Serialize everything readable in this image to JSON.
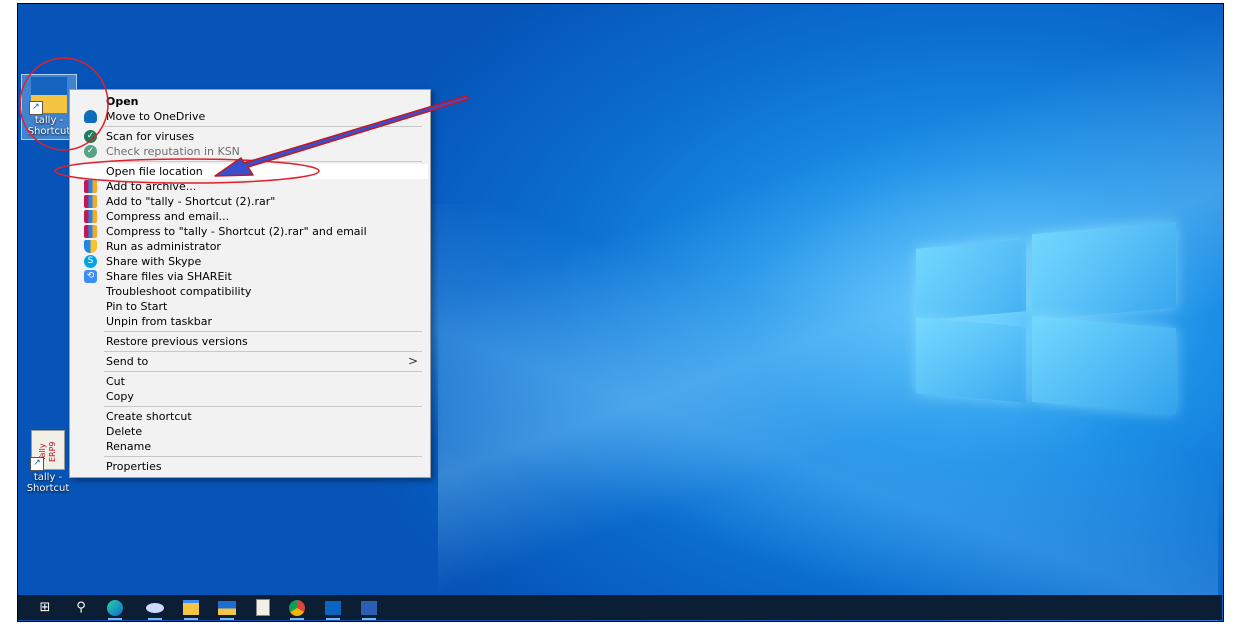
{
  "desktop": {
    "icons": [
      {
        "label": "tally - Shortcut",
        "name": "tally-shortcut-selected"
      },
      {
        "label": "tally - Shortcut",
        "name": "tally-erp9-shortcut"
      }
    ],
    "icon2_art_text": "Tally ERP9"
  },
  "context_menu": {
    "items": {
      "open": "Open",
      "move_onedrive": "Move to OneDrive",
      "scan": "Scan for viruses",
      "check_reputation": "Check reputation in KSN",
      "open_file_location": "Open file location",
      "add_archive": "Add to archive...",
      "add_to_rar": "Add to \"tally - Shortcut (2).rar\"",
      "compress_email": "Compress and email...",
      "compress_to_rar_email": "Compress to \"tally - Shortcut (2).rar\" and email",
      "run_admin": "Run as administrator",
      "share_skype": "Share with Skype",
      "share_shareit": "Share files via SHAREit",
      "troubleshoot": "Troubleshoot compatibility",
      "pin_start": "Pin to Start",
      "unpin_taskbar": "Unpin from taskbar",
      "restore_versions": "Restore previous versions",
      "send_to": "Send to",
      "cut": "Cut",
      "copy": "Copy",
      "create_shortcut": "Create shortcut",
      "delete": "Delete",
      "rename": "Rename",
      "properties": "Properties"
    },
    "submenu_arrow": ">"
  },
  "taskbar": {
    "icons": [
      "start-icon",
      "search-icon",
      "edge-icon",
      "app-icon",
      "file-explorer-icon",
      "blue-app-icon",
      "tally-app-icon",
      "chrome-icon",
      "outlook-icon",
      "word-icon"
    ]
  },
  "colors": {
    "highlight_circle": "#e0202a",
    "arrow": "#c4161c",
    "arrow_fill": "#3a4fd0"
  }
}
